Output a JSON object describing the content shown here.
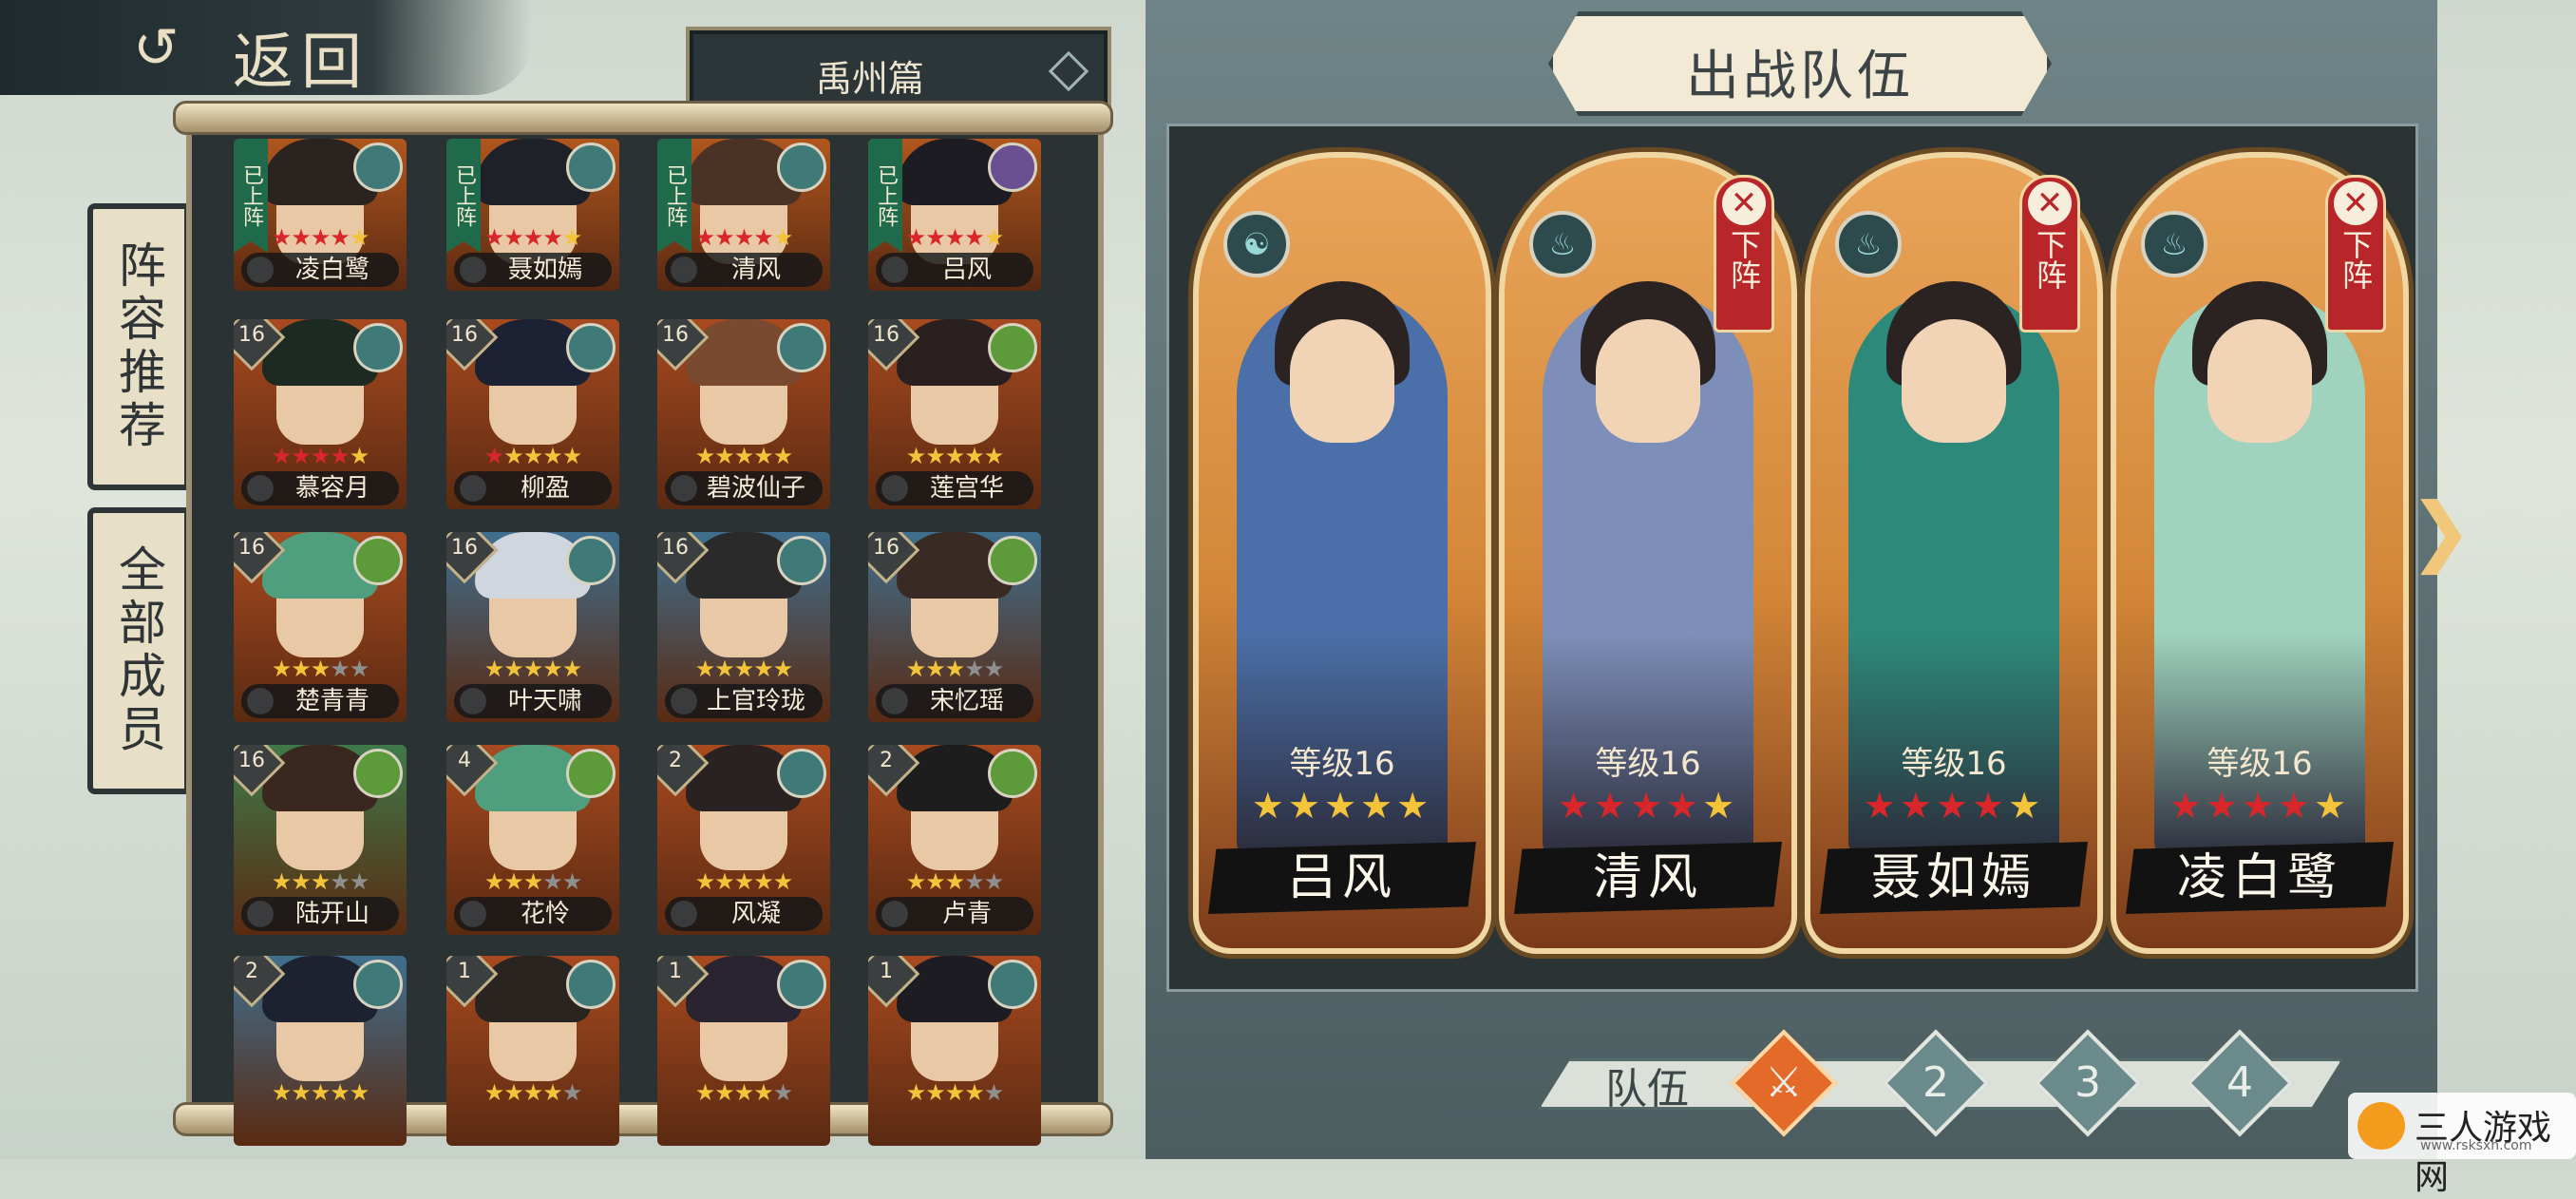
{
  "back_button": {
    "label": "返回"
  },
  "chapter_select": {
    "value": "禹州篇"
  },
  "side_tabs": [
    {
      "label": "阵容推荐"
    },
    {
      "label": "全部成员"
    }
  ],
  "roster": [
    {
      "name": "凌白鹭",
      "level": "",
      "stars": 5,
      "red": 4,
      "on_team": true,
      "on_label": "已上阵",
      "elem": "#3f7a78",
      "bg": "#b0561e",
      "hair": "#2a2320"
    },
    {
      "name": "聂如嫣",
      "level": "",
      "stars": 5,
      "red": 4,
      "on_team": true,
      "on_label": "已上阵",
      "elem": "#3f7a78",
      "bg": "#b0561e",
      "hair": "#1e2228"
    },
    {
      "name": "清风",
      "level": "",
      "stars": 5,
      "red": 4,
      "on_team": true,
      "on_label": "已上阵",
      "elem": "#3f7a78",
      "bg": "#b0561e",
      "hair": "#4a3225"
    },
    {
      "name": "吕风",
      "level": "",
      "stars": 5,
      "red": 4,
      "on_team": true,
      "on_label": "已上阵",
      "elem": "#6a4f93",
      "bg": "#b0561e",
      "hair": "#1c1c22"
    },
    {
      "name": "慕容月",
      "level": "16",
      "stars": 5,
      "red": 4,
      "on_team": false,
      "elem": "#3f7a78",
      "bg": "#a84a1f",
      "hair": "#1d2a22"
    },
    {
      "name": "柳盈",
      "level": "16",
      "stars": 5,
      "red": 1,
      "on_team": false,
      "elem": "#3f7a78",
      "bg": "#a84a1f",
      "hair": "#1c2233"
    },
    {
      "name": "碧波仙子",
      "level": "16",
      "stars": 5,
      "red": 0,
      "on_team": false,
      "elem": "#3f7a78",
      "bg": "#a84a1f",
      "hair": "#7a4a30"
    },
    {
      "name": "莲宫华",
      "level": "16",
      "stars": 5,
      "red": 0,
      "on_team": false,
      "elem": "#5d9a3a",
      "bg": "#a84a1f",
      "hair": "#2a2020"
    },
    {
      "name": "楚青青",
      "level": "16",
      "stars": 3,
      "red": 0,
      "on_team": false,
      "elem": "#5d9a3a",
      "bg": "#a84a1f",
      "hair": "#4f9e7e"
    },
    {
      "name": "叶天啸",
      "level": "16",
      "stars": 5,
      "red": 0,
      "on_team": false,
      "elem": "#3f7a78",
      "bg": "#3f6f8e",
      "hair": "#cfd6de"
    },
    {
      "name": "上官玲珑",
      "level": "16",
      "stars": 5,
      "red": 0,
      "on_team": false,
      "elem": "#3f7a78",
      "bg": "#3f6f8e",
      "hair": "#2a2a2a"
    },
    {
      "name": "宋忆瑶",
      "level": "16",
      "stars": 3,
      "red": 0,
      "on_team": false,
      "elem": "#5d9a3a",
      "bg": "#3f6f8e",
      "hair": "#3a2a24"
    },
    {
      "name": "陆开山",
      "level": "16",
      "stars": 3,
      "red": 0,
      "on_team": false,
      "elem": "#5d9a3a",
      "bg": "#3f7a4a",
      "hair": "#3a2820"
    },
    {
      "name": "花怜",
      "level": "4",
      "stars": 3,
      "red": 0,
      "on_team": false,
      "elem": "#5d9a3a",
      "bg": "#a84a1f",
      "hair": "#4f9e7e"
    },
    {
      "name": "风凝",
      "level": "2",
      "stars": 5,
      "red": 0,
      "on_team": false,
      "elem": "#3f7a78",
      "bg": "#a84a1f",
      "hair": "#2a2222"
    },
    {
      "name": "卢青",
      "level": "2",
      "stars": 3,
      "red": 0,
      "on_team": false,
      "elem": "#5d9a3a",
      "bg": "#a84a1f",
      "hair": "#1d1d1d"
    },
    {
      "name": "",
      "level": "2",
      "stars": 5,
      "red": 0,
      "on_team": false,
      "elem": "#3f7a78",
      "bg": "#3f6f8e",
      "hair": "#1d2230"
    },
    {
      "name": "",
      "level": "1",
      "stars": 4,
      "red": 0,
      "on_team": false,
      "elem": "#3f7a78",
      "bg": "#a84a1f",
      "hair": "#2a2420"
    },
    {
      "name": "",
      "level": "1",
      "stars": 4,
      "red": 0,
      "on_team": false,
      "elem": "#3f7a78",
      "bg": "#a84a1f",
      "hair": "#2a2430"
    },
    {
      "name": "",
      "level": "1",
      "stars": 4,
      "red": 0,
      "on_team": false,
      "elem": "#3f7a78",
      "bg": "#a84a1f",
      "hair": "#1c1c22"
    }
  ],
  "team_panel": {
    "title": "出战队伍",
    "remove_label": "下阵",
    "heroes": [
      {
        "name": "吕风",
        "level": "等级16",
        "stars": 5,
        "red": 0,
        "removable": false,
        "elem_glyph": "☯",
        "outfit": "#4b6fa8"
      },
      {
        "name": "清风",
        "level": "等级16",
        "stars": 5,
        "red": 4,
        "removable": true,
        "elem_glyph": "♨",
        "outfit": "#7d8fb8"
      },
      {
        "name": "聂如嫣",
        "level": "等级16",
        "stars": 5,
        "red": 4,
        "removable": true,
        "elem_glyph": "♨",
        "outfit": "#2d8a7a"
      },
      {
        "name": "凌白鹭",
        "level": "等级16",
        "stars": 5,
        "red": 4,
        "removable": true,
        "elem_glyph": "♨",
        "outfit": "#9fd3bd"
      }
    ]
  },
  "team_selector": {
    "label": "队伍",
    "teams": [
      "",
      "2",
      "3",
      "4"
    ],
    "active": 0
  },
  "watermark": {
    "text": "三人游戏网",
    "url": "www.rsksxh.com"
  }
}
